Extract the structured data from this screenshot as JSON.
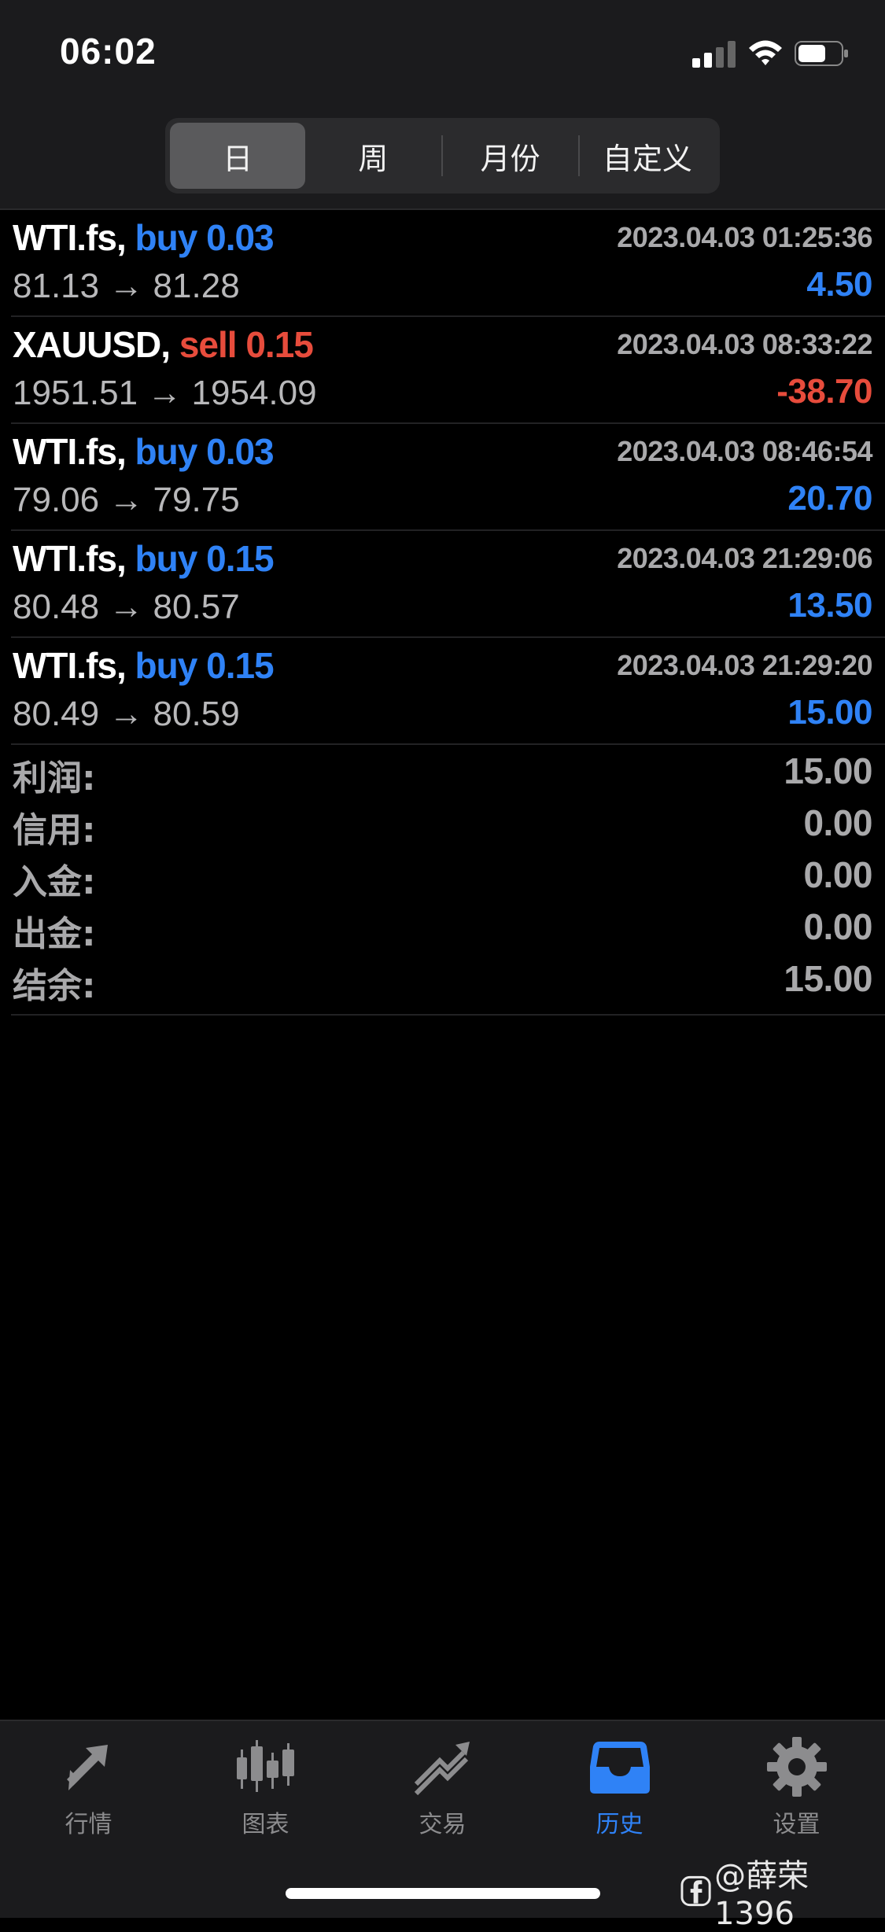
{
  "status_bar": {
    "time": "06:02"
  },
  "segments": [
    {
      "label": "日",
      "active": true
    },
    {
      "label": "周",
      "active": false
    },
    {
      "label": "月份",
      "active": false
    },
    {
      "label": "自定义",
      "active": false
    }
  ],
  "trades": [
    {
      "symbol": "WTI.fs,",
      "side": "buy",
      "volume": "0.03",
      "time": "2023.04.03 01:25:36",
      "prices": "81.13 → 81.28",
      "profit": "4.50"
    },
    {
      "symbol": "XAUUSD,",
      "side": "sell",
      "volume": "0.15",
      "time": "2023.04.03 08:33:22",
      "prices": "1951.51 → 1954.09",
      "profit": "-38.70"
    },
    {
      "symbol": "WTI.fs,",
      "side": "buy",
      "volume": "0.03",
      "time": "2023.04.03 08:46:54",
      "prices": "79.06 → 79.75",
      "profit": "20.70"
    },
    {
      "symbol": "WTI.fs,",
      "side": "buy",
      "volume": "0.15",
      "time": "2023.04.03 21:29:06",
      "prices": "80.48 → 80.57",
      "profit": "13.50"
    },
    {
      "symbol": "WTI.fs,",
      "side": "buy",
      "volume": "0.15",
      "time": "2023.04.03 21:29:20",
      "prices": "80.49 → 80.59",
      "profit": "15.00"
    }
  ],
  "summary": [
    {
      "label": "利润:",
      "value": "15.00"
    },
    {
      "label": "信用:",
      "value": "0.00"
    },
    {
      "label": "入金:",
      "value": "0.00"
    },
    {
      "label": "出金:",
      "value": "0.00"
    },
    {
      "label": "结余:",
      "value": "15.00"
    }
  ],
  "tabs": [
    {
      "label": "行情",
      "icon": "quotes-arrows-icon",
      "active": false
    },
    {
      "label": "图表",
      "icon": "candlestick-chart-icon",
      "active": false
    },
    {
      "label": "交易",
      "icon": "trade-trend-icon",
      "active": false
    },
    {
      "label": "历史",
      "icon": "history-inbox-icon",
      "active": true
    },
    {
      "label": "设置",
      "icon": "gear-icon",
      "active": false
    }
  ],
  "watermark": "@薛荣1396",
  "colors": {
    "accent_blue": "#2f82f6",
    "loss_red": "#e74c3c",
    "muted_gray": "#a9a9ab",
    "background": "#000000",
    "bar_background": "#1b1b1d"
  }
}
